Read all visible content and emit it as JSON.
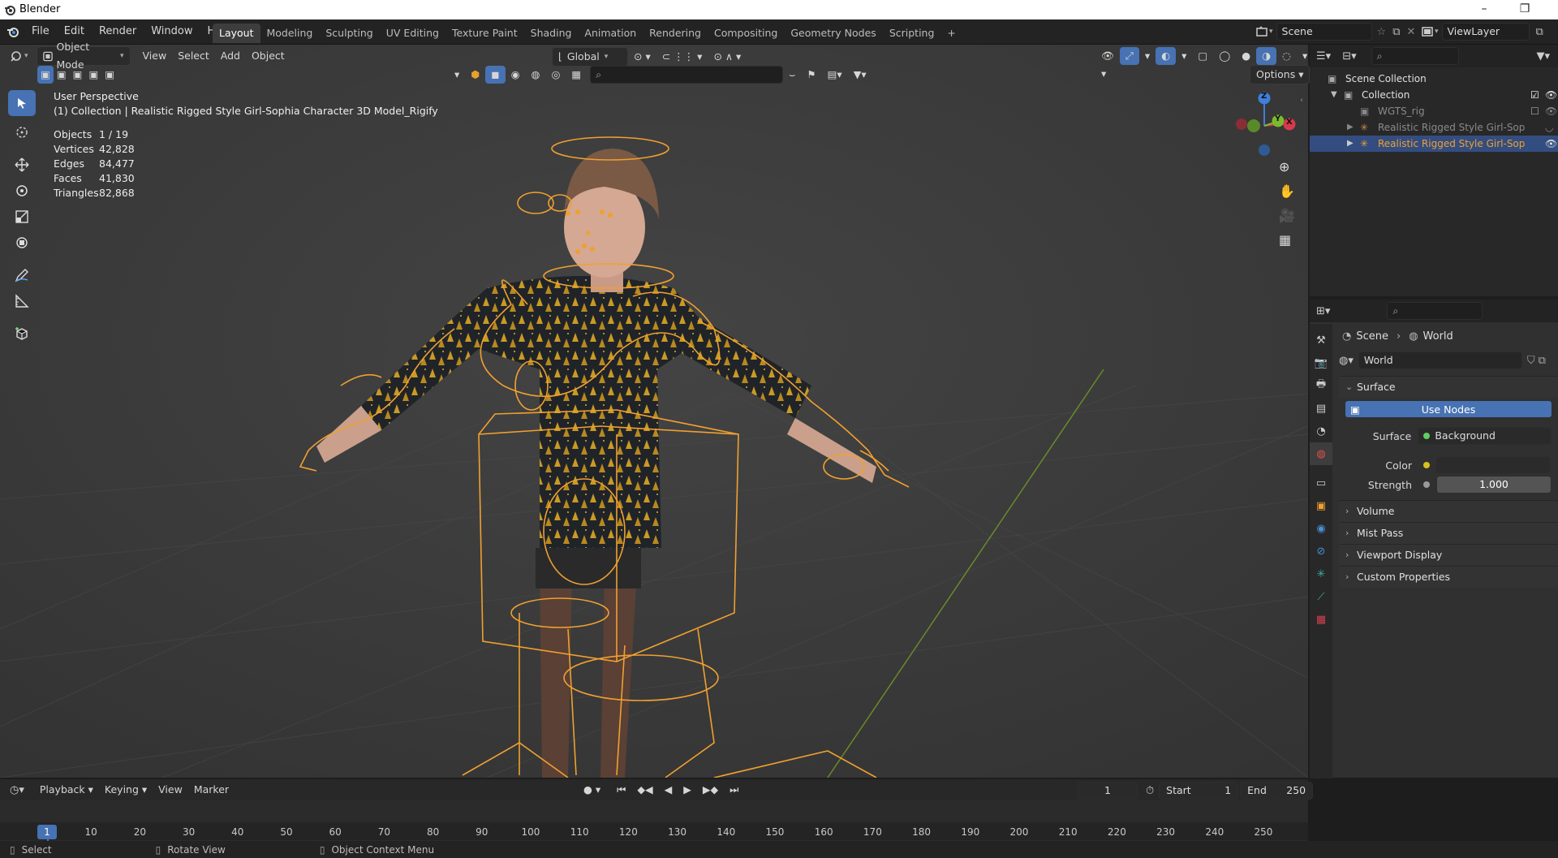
{
  "window": {
    "title": "Blender"
  },
  "menubar": {
    "items": [
      "File",
      "Edit",
      "Render",
      "Window",
      "Help"
    ]
  },
  "workspaces": {
    "tabs": [
      "Layout",
      "Modeling",
      "Sculpting",
      "UV Editing",
      "Texture Paint",
      "Shading",
      "Animation",
      "Rendering",
      "Compositing",
      "Geometry Nodes",
      "Scripting"
    ],
    "active": "Layout",
    "add": "+"
  },
  "scene": {
    "name": "Scene",
    "view_layer": "ViewLayer"
  },
  "viewport": {
    "mode": "Object Mode",
    "menus": [
      "View",
      "Select",
      "Add",
      "Object"
    ],
    "orientation": "Global",
    "options": "Options",
    "perspective": "User Perspective",
    "collection_info": "(1) Collection | Realistic Rigged Style Girl-Sophia Character 3D Model_Rigify",
    "stats": [
      {
        "label": "Objects",
        "value": "1 / 19"
      },
      {
        "label": "Vertices",
        "value": "42,828"
      },
      {
        "label": "Edges",
        "value": "84,477"
      },
      {
        "label": "Faces",
        "value": "41,830"
      },
      {
        "label": "Triangles",
        "value": "82,868"
      }
    ],
    "gizmo": {
      "z": "Z",
      "y": "Y",
      "x": "X"
    }
  },
  "outliner": {
    "rows": [
      {
        "label": "Scene Collection",
        "indent": 0
      },
      {
        "label": "Collection",
        "indent": 1
      },
      {
        "label": "WGTS_rig",
        "indent": 2
      },
      {
        "label": "Realistic Rigged Style Girl-Sophia Cl",
        "indent": 2
      },
      {
        "label": "Realistic Rigged Style Girl-Sophia Cl",
        "indent": 2
      }
    ]
  },
  "properties": {
    "breadcrumb": [
      "Scene",
      "World"
    ],
    "world_name": "World",
    "surface_panel": "Surface",
    "use_nodes": "Use Nodes",
    "surface_label": "Surface",
    "surface_value": "Background",
    "color_label": "Color",
    "strength_label": "Strength",
    "strength_value": "1.000",
    "panels": [
      "Volume",
      "Mist Pass",
      "Viewport Display",
      "Custom Properties"
    ]
  },
  "timeline": {
    "menus": [
      "Playback",
      "Keying",
      "View",
      "Marker"
    ],
    "current_frame": "1",
    "start_label": "Start",
    "start": "1",
    "end_label": "End",
    "end": "250",
    "ticks": [
      "1",
      "10",
      "20",
      "30",
      "40",
      "50",
      "60",
      "70",
      "80",
      "90",
      "100",
      "110",
      "120",
      "130",
      "140",
      "150",
      "160",
      "170",
      "180",
      "190",
      "200",
      "210",
      "220",
      "230",
      "240",
      "250"
    ]
  },
  "statusbar": {
    "items": [
      "Select",
      "Rotate View",
      "Object Context Menu"
    ]
  },
  "colors": {
    "accent": "#4772b3",
    "selection": "#f0a030",
    "background": "#3a3a3a"
  }
}
